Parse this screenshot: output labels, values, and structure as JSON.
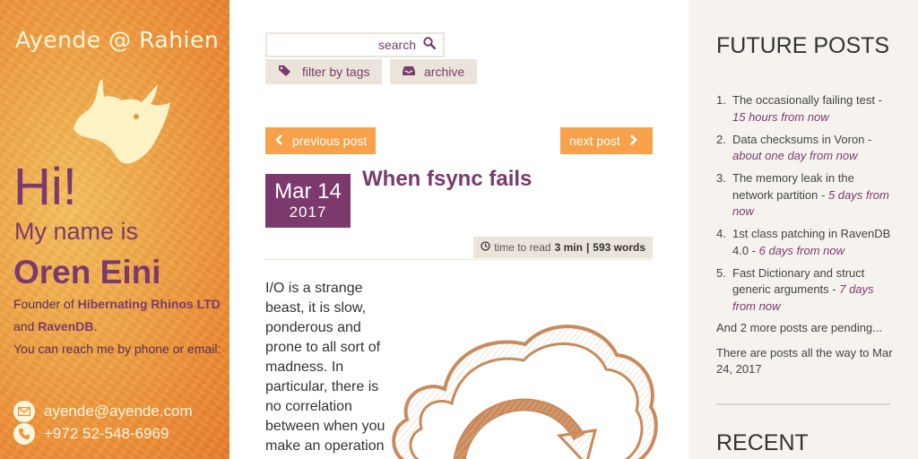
{
  "sidebar": {
    "site_title": "Ayende @ Rahien",
    "hi": "Hi!",
    "my_name_is": "My name is",
    "name": "Oren Eini",
    "bio_prefix": "Founder of ",
    "company1": "Hibernating Rhinos LTD",
    "bio_and": " and ",
    "company2": "RavenDB",
    "bio_period": ".",
    "reach": "You can reach me by phone or email:",
    "email": "ayende@ayende.com",
    "phone": "+972 52-548-6969",
    "icons": [
      "rhino-logo",
      "envelope-icon",
      "phone-icon"
    ]
  },
  "toolbar": {
    "search_placeholder": "search",
    "filter_label": "filter by tags",
    "archive_label": "archive"
  },
  "nav": {
    "previous": "previous post",
    "next": "next post"
  },
  "post": {
    "month_day": "Mar 14",
    "year": "2017",
    "title": "When fsync fails",
    "time_to_read_label": "time to read",
    "minutes": "3 min",
    "words_sep": "|",
    "words": "593 words",
    "body": "I/O is a strange beast, it is slow, ponderous and prone to all sort of madness. In particular, there is no correlation between when you make an operation"
  },
  "right": {
    "future_title": "FUTURE POSTS",
    "future_posts": [
      {
        "number": "1.",
        "title": "The occasionally failing test - ",
        "when": "15 hours from now"
      },
      {
        "number": "2.",
        "title": "Data checksums in Voron - ",
        "when": "about one day from now"
      },
      {
        "number": "3.",
        "title": "The memory leak in the network partition - ",
        "when": "5 days from now"
      },
      {
        "number": "4.",
        "title": "1st class patching in RavenDB 4.0 - ",
        "when": "6 days from now"
      },
      {
        "number": "5.",
        "title": "Fast Dictionary and struct generic arguments - ",
        "when": "7 days from now"
      }
    ],
    "pending": "And 2 more posts are pending...",
    "all_the_way": "There are posts all the way to Mar 24, 2017",
    "recent_title": "RECENT"
  },
  "colors": {
    "accent": "#7b3a6b",
    "orange": "#f7a24a",
    "cream": "#fff6dc",
    "chip": "#ebe4da",
    "right_bg": "#f6f3ef"
  }
}
